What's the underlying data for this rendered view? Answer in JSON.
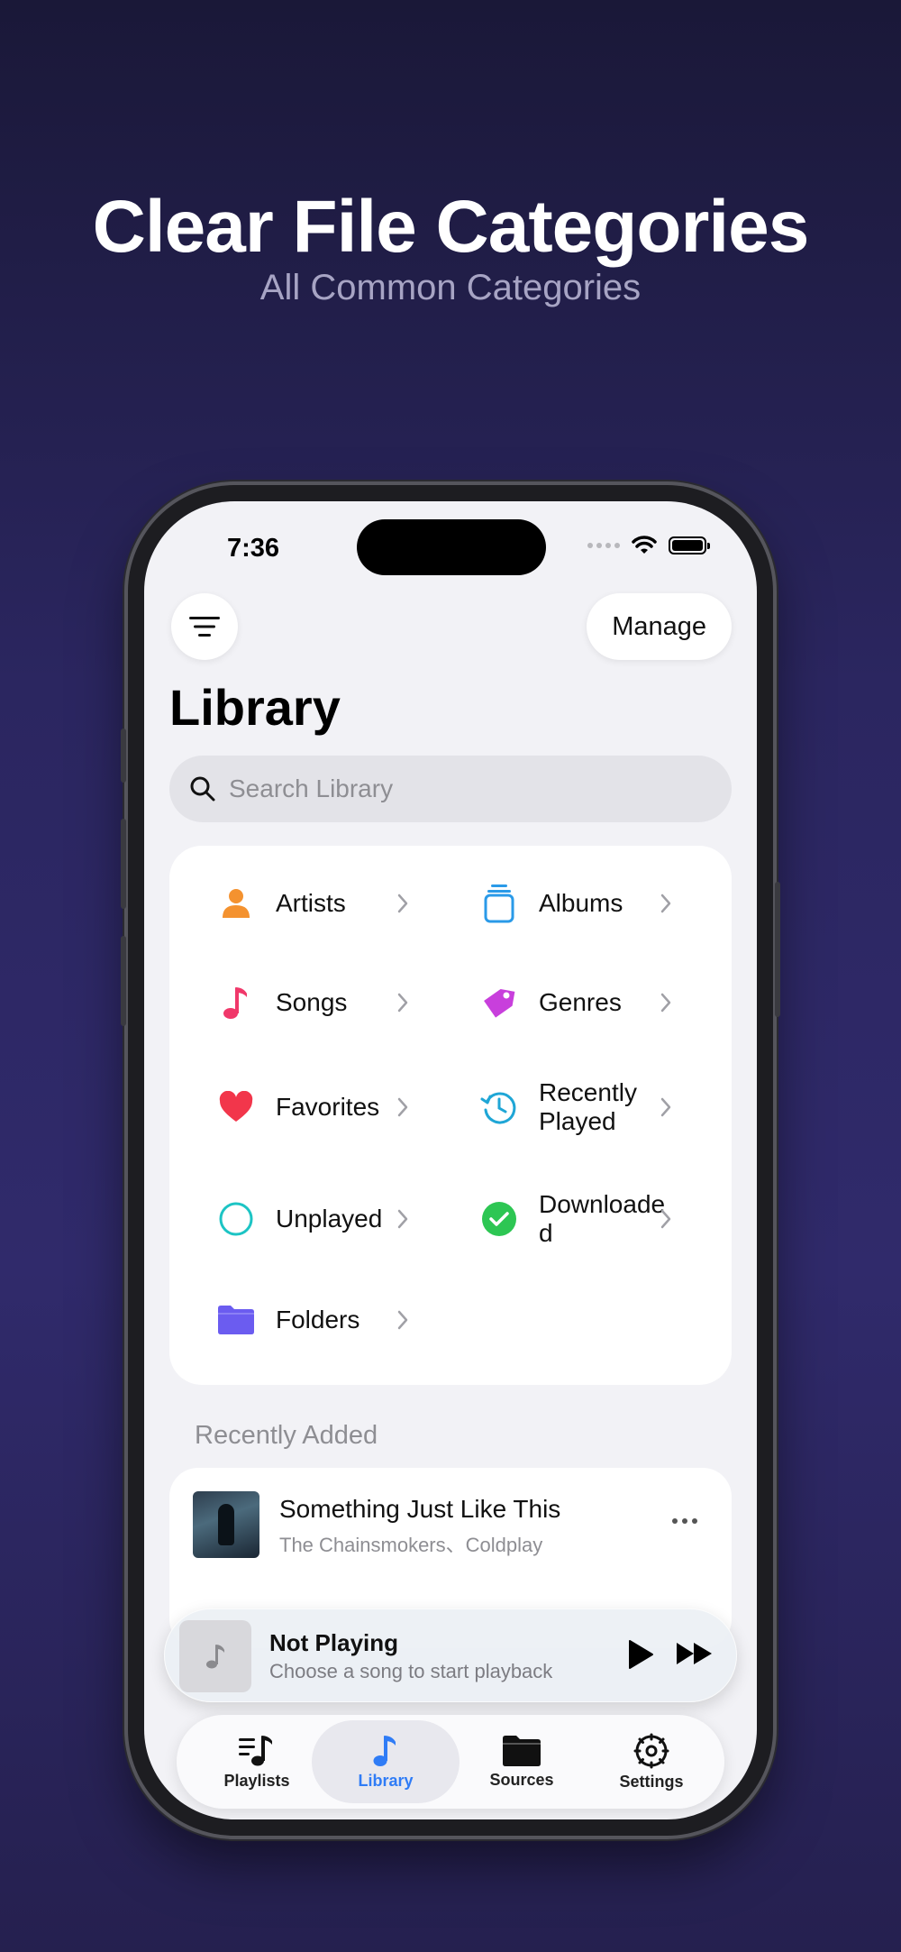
{
  "hero": {
    "title": "Clear File Categories",
    "subtitle": "All Common Categories"
  },
  "status_bar": {
    "time": "7:36"
  },
  "header": {
    "manage_label": "Manage",
    "title": "Library"
  },
  "search": {
    "placeholder": "Search Library"
  },
  "categories": [
    {
      "label": "Artists",
      "icon": "person-icon",
      "color": "#f4922f"
    },
    {
      "label": "Albums",
      "icon": "albums-stack-icon",
      "color": "#2a9ae8"
    },
    {
      "label": "Songs",
      "icon": "music-note-icon",
      "color": "#f0386a"
    },
    {
      "label": "Genres",
      "icon": "tag-icon",
      "color": "#c83fdc"
    },
    {
      "label": "Favorites",
      "icon": "heart-icon",
      "color": "#f2364b"
    },
    {
      "label": "Recently Played",
      "icon": "history-clock-icon",
      "color": "#1fa6d6"
    },
    {
      "label": "Unplayed",
      "icon": "empty-circle-icon",
      "color": "#1cc4c4"
    },
    {
      "label": "Downloaded",
      "icon": "check-circle-icon",
      "color": "#2dc653"
    },
    {
      "label": "Folders",
      "icon": "folder-icon",
      "color": "#6b5cf0"
    }
  ],
  "recently_added": {
    "heading": "Recently Added",
    "items": [
      {
        "title": "Something Just Like This",
        "artist": "The Chainsmokers、Coldplay"
      }
    ]
  },
  "mini_player": {
    "title": "Not Playing",
    "subtitle": "Choose a song to start playback"
  },
  "tabs": [
    {
      "label": "Playlists",
      "icon": "playlist-icon",
      "active": false
    },
    {
      "label": "Library",
      "icon": "music-note-icon",
      "active": true
    },
    {
      "label": "Sources",
      "icon": "folder-icon",
      "active": false
    },
    {
      "label": "Settings",
      "icon": "gear-icon",
      "active": false
    }
  ],
  "colors": {
    "accent": "#2f7cf6",
    "background_top": "#1a1838",
    "background_mid": "#302a6b"
  }
}
